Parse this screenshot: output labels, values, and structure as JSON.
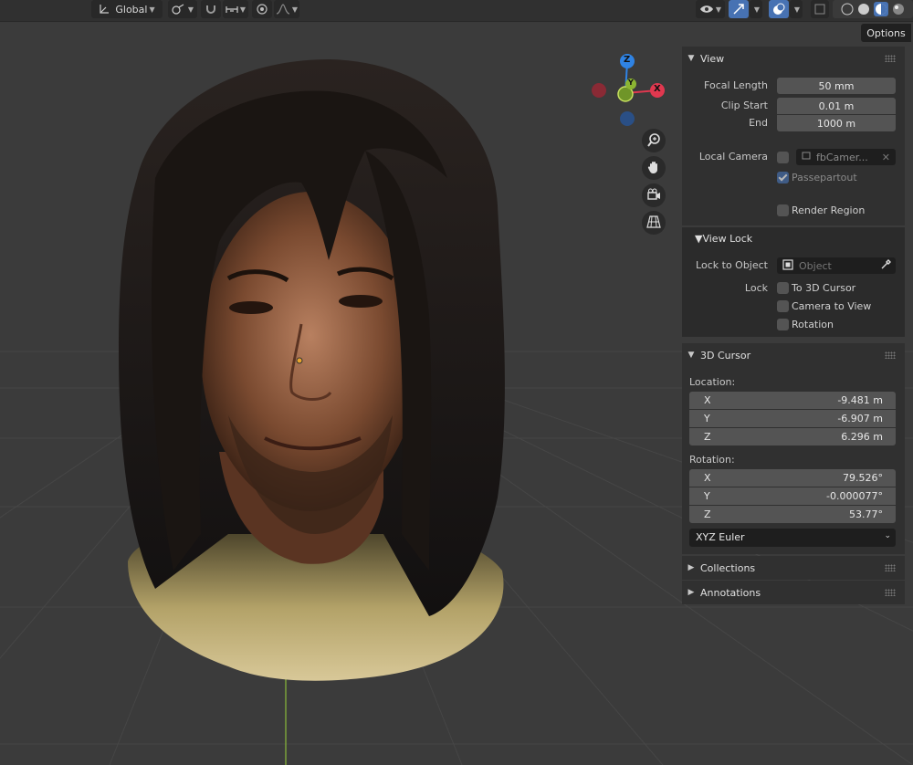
{
  "header": {
    "orientation_label": "Global",
    "options_label": "Options"
  },
  "sidebar": {
    "view": {
      "title": "View",
      "focal_length_label": "Focal Length",
      "focal_length_value": "50 mm",
      "clip_start_label": "Clip Start",
      "clip_start_value": "0.01 m",
      "clip_end_label": "End",
      "clip_end_value": "1000 m",
      "local_camera_label": "Local Camera",
      "local_camera_value": "fbCamer...",
      "passepartout_label": "Passepartout",
      "render_region_label": "Render Region"
    },
    "view_lock": {
      "title": "View Lock",
      "lock_to_object_label": "Lock to Object",
      "lock_to_object_placeholder": "Object",
      "lock_label": "Lock",
      "to_3d_cursor_label": "To 3D Cursor",
      "camera_to_view_label": "Camera to View",
      "rotation_label": "Rotation"
    },
    "cursor": {
      "title": "3D Cursor",
      "location_label": "Location:",
      "location": [
        {
          "axis": "X",
          "value": "-9.481 m"
        },
        {
          "axis": "Y",
          "value": "-6.907 m"
        },
        {
          "axis": "Z",
          "value": "6.296 m"
        }
      ],
      "rotation_label": "Rotation:",
      "rotation": [
        {
          "axis": "X",
          "value": "79.526°"
        },
        {
          "axis": "Y",
          "value": "-0.000077°"
        },
        {
          "axis": "Z",
          "value": "53.77°"
        }
      ],
      "rotation_mode": "XYZ Euler"
    },
    "collections_title": "Collections",
    "annotations_title": "Annotations"
  },
  "gizmo": {
    "z_label": "Z",
    "x_label": "X",
    "y_label": "Y"
  },
  "colors": {
    "accent": "#4772b3",
    "x_axis": "#e0384f",
    "y_axis": "#8bb532",
    "z_axis": "#2f83e4"
  }
}
